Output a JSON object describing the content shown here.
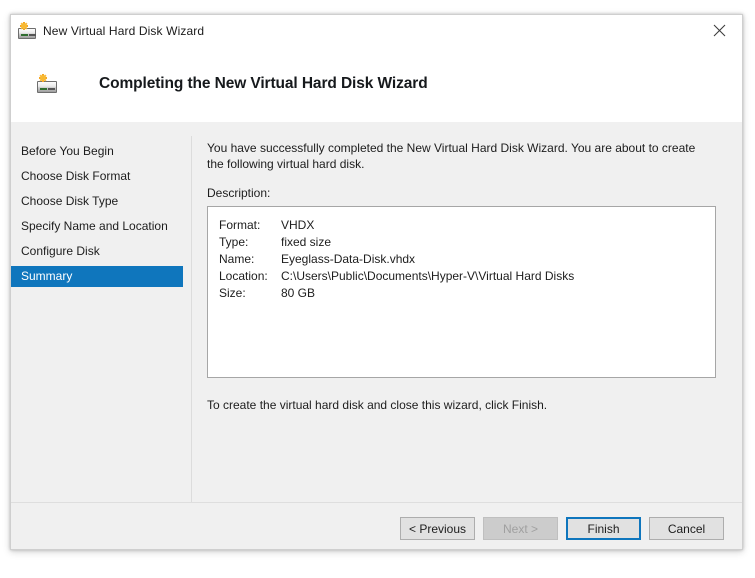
{
  "window": {
    "title": "New Virtual Hard Disk Wizard",
    "icon": "new-virtual-hard-disk-icon",
    "close_label": "✕"
  },
  "header": {
    "title": "Completing the New Virtual Hard Disk Wizard",
    "icon": "new-virtual-hard-disk-icon"
  },
  "sidebar": {
    "items": [
      {
        "label": "Before You Begin",
        "active": false
      },
      {
        "label": "Choose Disk Format",
        "active": false
      },
      {
        "label": "Choose Disk Type",
        "active": false
      },
      {
        "label": "Specify Name and Location",
        "active": false
      },
      {
        "label": "Configure Disk",
        "active": false
      },
      {
        "label": "Summary",
        "active": true
      }
    ],
    "active_color": "#0f76bd"
  },
  "main": {
    "intro": "You have successfully completed the New Virtual Hard Disk Wizard. You are about to create the following virtual hard disk.",
    "description_label": "Description:",
    "description": [
      {
        "key": "Format:",
        "value": "VHDX"
      },
      {
        "key": "Type:",
        "value": "fixed size"
      },
      {
        "key": "Name:",
        "value": "Eyeglass-Data-Disk.vhdx"
      },
      {
        "key": "Location:",
        "value": "C:\\Users\\Public\\Documents\\Hyper-V\\Virtual Hard Disks"
      },
      {
        "key": "Size:",
        "value": "80 GB"
      }
    ],
    "outro": "To create the virtual hard disk and close this wizard, click Finish."
  },
  "footer": {
    "buttons": [
      {
        "label": "< Previous",
        "state": "enabled"
      },
      {
        "label": "Next >",
        "state": "disabled"
      },
      {
        "label": "Finish",
        "state": "default"
      },
      {
        "label": "Cancel",
        "state": "enabled"
      }
    ]
  }
}
